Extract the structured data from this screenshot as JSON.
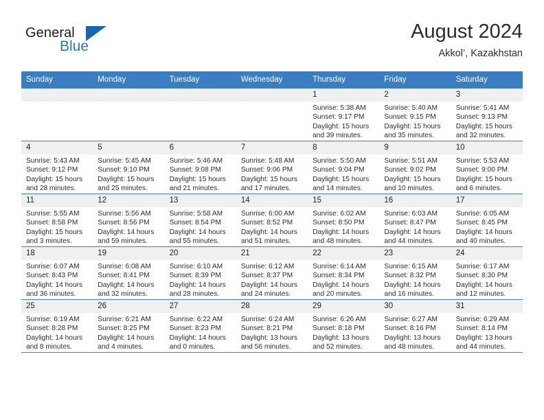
{
  "brand": {
    "name_part1": "General",
    "name_part2": "Blue",
    "logo_icon": "triangle-flag-icon"
  },
  "header": {
    "title": "August 2024",
    "subtitle": "Akkol’, Kazakhstan"
  },
  "calendar": {
    "weekday_headers": [
      "Sunday",
      "Monday",
      "Tuesday",
      "Wednesday",
      "Thursday",
      "Friday",
      "Saturday"
    ],
    "accent_color": "#3a7dc0",
    "daynum_bg": "#f0f0f0",
    "weeks": [
      [
        {
          "day": "",
          "lines": []
        },
        {
          "day": "",
          "lines": []
        },
        {
          "day": "",
          "lines": []
        },
        {
          "day": "",
          "lines": []
        },
        {
          "day": "1",
          "lines": [
            "Sunrise: 5:38 AM",
            "Sunset: 9:17 PM",
            "Daylight: 15 hours",
            "and 39 minutes."
          ]
        },
        {
          "day": "2",
          "lines": [
            "Sunrise: 5:40 AM",
            "Sunset: 9:15 PM",
            "Daylight: 15 hours",
            "and 35 minutes."
          ]
        },
        {
          "day": "3",
          "lines": [
            "Sunrise: 5:41 AM",
            "Sunset: 9:13 PM",
            "Daylight: 15 hours",
            "and 32 minutes."
          ]
        }
      ],
      [
        {
          "day": "4",
          "lines": [
            "Sunrise: 5:43 AM",
            "Sunset: 9:12 PM",
            "Daylight: 15 hours",
            "and 28 minutes."
          ]
        },
        {
          "day": "5",
          "lines": [
            "Sunrise: 5:45 AM",
            "Sunset: 9:10 PM",
            "Daylight: 15 hours",
            "and 25 minutes."
          ]
        },
        {
          "day": "6",
          "lines": [
            "Sunrise: 5:46 AM",
            "Sunset: 9:08 PM",
            "Daylight: 15 hours",
            "and 21 minutes."
          ]
        },
        {
          "day": "7",
          "lines": [
            "Sunrise: 5:48 AM",
            "Sunset: 9:06 PM",
            "Daylight: 15 hours",
            "and 17 minutes."
          ]
        },
        {
          "day": "8",
          "lines": [
            "Sunrise: 5:50 AM",
            "Sunset: 9:04 PM",
            "Daylight: 15 hours",
            "and 14 minutes."
          ]
        },
        {
          "day": "9",
          "lines": [
            "Sunrise: 5:51 AM",
            "Sunset: 9:02 PM",
            "Daylight: 15 hours",
            "and 10 minutes."
          ]
        },
        {
          "day": "10",
          "lines": [
            "Sunrise: 5:53 AM",
            "Sunset: 9:00 PM",
            "Daylight: 15 hours",
            "and 6 minutes."
          ]
        }
      ],
      [
        {
          "day": "11",
          "lines": [
            "Sunrise: 5:55 AM",
            "Sunset: 8:58 PM",
            "Daylight: 15 hours",
            "and 3 minutes."
          ]
        },
        {
          "day": "12",
          "lines": [
            "Sunrise: 5:56 AM",
            "Sunset: 8:56 PM",
            "Daylight: 14 hours",
            "and 59 minutes."
          ]
        },
        {
          "day": "13",
          "lines": [
            "Sunrise: 5:58 AM",
            "Sunset: 8:54 PM",
            "Daylight: 14 hours",
            "and 55 minutes."
          ]
        },
        {
          "day": "14",
          "lines": [
            "Sunrise: 6:00 AM",
            "Sunset: 8:52 PM",
            "Daylight: 14 hours",
            "and 51 minutes."
          ]
        },
        {
          "day": "15",
          "lines": [
            "Sunrise: 6:02 AM",
            "Sunset: 8:50 PM",
            "Daylight: 14 hours",
            "and 48 minutes."
          ]
        },
        {
          "day": "16",
          "lines": [
            "Sunrise: 6:03 AM",
            "Sunset: 8:47 PM",
            "Daylight: 14 hours",
            "and 44 minutes."
          ]
        },
        {
          "day": "17",
          "lines": [
            "Sunrise: 6:05 AM",
            "Sunset: 8:45 PM",
            "Daylight: 14 hours",
            "and 40 minutes."
          ]
        }
      ],
      [
        {
          "day": "18",
          "lines": [
            "Sunrise: 6:07 AM",
            "Sunset: 8:43 PM",
            "Daylight: 14 hours",
            "and 36 minutes."
          ]
        },
        {
          "day": "19",
          "lines": [
            "Sunrise: 6:08 AM",
            "Sunset: 8:41 PM",
            "Daylight: 14 hours",
            "and 32 minutes."
          ]
        },
        {
          "day": "20",
          "lines": [
            "Sunrise: 6:10 AM",
            "Sunset: 8:39 PM",
            "Daylight: 14 hours",
            "and 28 minutes."
          ]
        },
        {
          "day": "21",
          "lines": [
            "Sunrise: 6:12 AM",
            "Sunset: 8:37 PM",
            "Daylight: 14 hours",
            "and 24 minutes."
          ]
        },
        {
          "day": "22",
          "lines": [
            "Sunrise: 6:14 AM",
            "Sunset: 8:34 PM",
            "Daylight: 14 hours",
            "and 20 minutes."
          ]
        },
        {
          "day": "23",
          "lines": [
            "Sunrise: 6:15 AM",
            "Sunset: 8:32 PM",
            "Daylight: 14 hours",
            "and 16 minutes."
          ]
        },
        {
          "day": "24",
          "lines": [
            "Sunrise: 6:17 AM",
            "Sunset: 8:30 PM",
            "Daylight: 14 hours",
            "and 12 minutes."
          ]
        }
      ],
      [
        {
          "day": "25",
          "lines": [
            "Sunrise: 6:19 AM",
            "Sunset: 8:28 PM",
            "Daylight: 14 hours",
            "and 8 minutes."
          ]
        },
        {
          "day": "26",
          "lines": [
            "Sunrise: 6:21 AM",
            "Sunset: 8:25 PM",
            "Daylight: 14 hours",
            "and 4 minutes."
          ]
        },
        {
          "day": "27",
          "lines": [
            "Sunrise: 6:22 AM",
            "Sunset: 8:23 PM",
            "Daylight: 14 hours",
            "and 0 minutes."
          ]
        },
        {
          "day": "28",
          "lines": [
            "Sunrise: 6:24 AM",
            "Sunset: 8:21 PM",
            "Daylight: 13 hours",
            "and 56 minutes."
          ]
        },
        {
          "day": "29",
          "lines": [
            "Sunrise: 6:26 AM",
            "Sunset: 8:18 PM",
            "Daylight: 13 hours",
            "and 52 minutes."
          ]
        },
        {
          "day": "30",
          "lines": [
            "Sunrise: 6:27 AM",
            "Sunset: 8:16 PM",
            "Daylight: 13 hours",
            "and 48 minutes."
          ]
        },
        {
          "day": "31",
          "lines": [
            "Sunrise: 6:29 AM",
            "Sunset: 8:14 PM",
            "Daylight: 13 hours",
            "and 44 minutes."
          ]
        }
      ]
    ]
  }
}
